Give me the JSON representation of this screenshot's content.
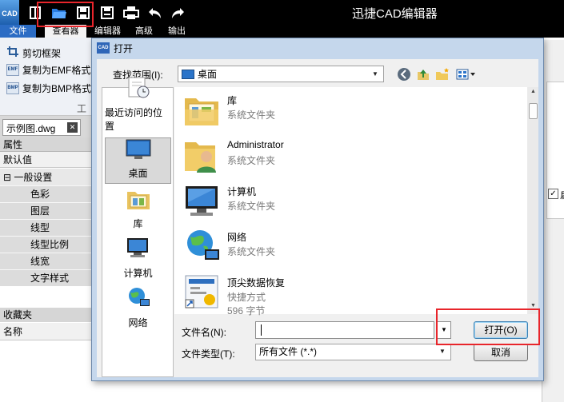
{
  "app": {
    "logo_text": "CAD",
    "title": "迅捷CAD编辑器",
    "ribbon_tabs": [
      "文件",
      "查看器",
      "编辑器",
      "高级",
      "输出"
    ],
    "ribbon_items": [
      "剪切框架",
      "复制为EMF格式",
      "复制为BMP格式"
    ],
    "ribbon_icon_texts": [
      "EMF",
      "BMP"
    ],
    "ribbon_group": "工",
    "doc_tab": "示例图.dwg",
    "props_header": "属性",
    "props_default": "默认值",
    "props_group": "一般设置",
    "props_rows": [
      "色彩",
      "图层",
      "线型",
      "线型比例",
      "线宽",
      "文字样式"
    ],
    "favorites_header": "收藏夹",
    "favorites_name": "名称",
    "checkbox_label": "启"
  },
  "dialog": {
    "icon_text": "CAD",
    "title": "打开",
    "look_in_label": "查找范围(I):",
    "look_in_value": "桌面",
    "places": [
      "最近访问的位置",
      "桌面",
      "库",
      "计算机",
      "网络"
    ],
    "files": [
      {
        "name": "库",
        "type": "系统文件夹"
      },
      {
        "name": "Administrator",
        "type": "系统文件夹"
      },
      {
        "name": "计算机",
        "type": "系统文件夹"
      },
      {
        "name": "网络",
        "type": "系统文件夹"
      },
      {
        "name": "顶尖数据恢复",
        "type": "快捷方式",
        "size": "596 字节"
      }
    ],
    "filename_label": "文件名(N):",
    "filename_value": "",
    "filetype_label": "文件类型(T):",
    "filetype_value": "所有文件 (*.*)",
    "open_button": "打开(O)",
    "cancel_button": "取消"
  },
  "colors": {
    "highlight_box": "#e8252b",
    "dialog_frame": "#c5d7ec",
    "file_tab": "#2b6cc4"
  }
}
